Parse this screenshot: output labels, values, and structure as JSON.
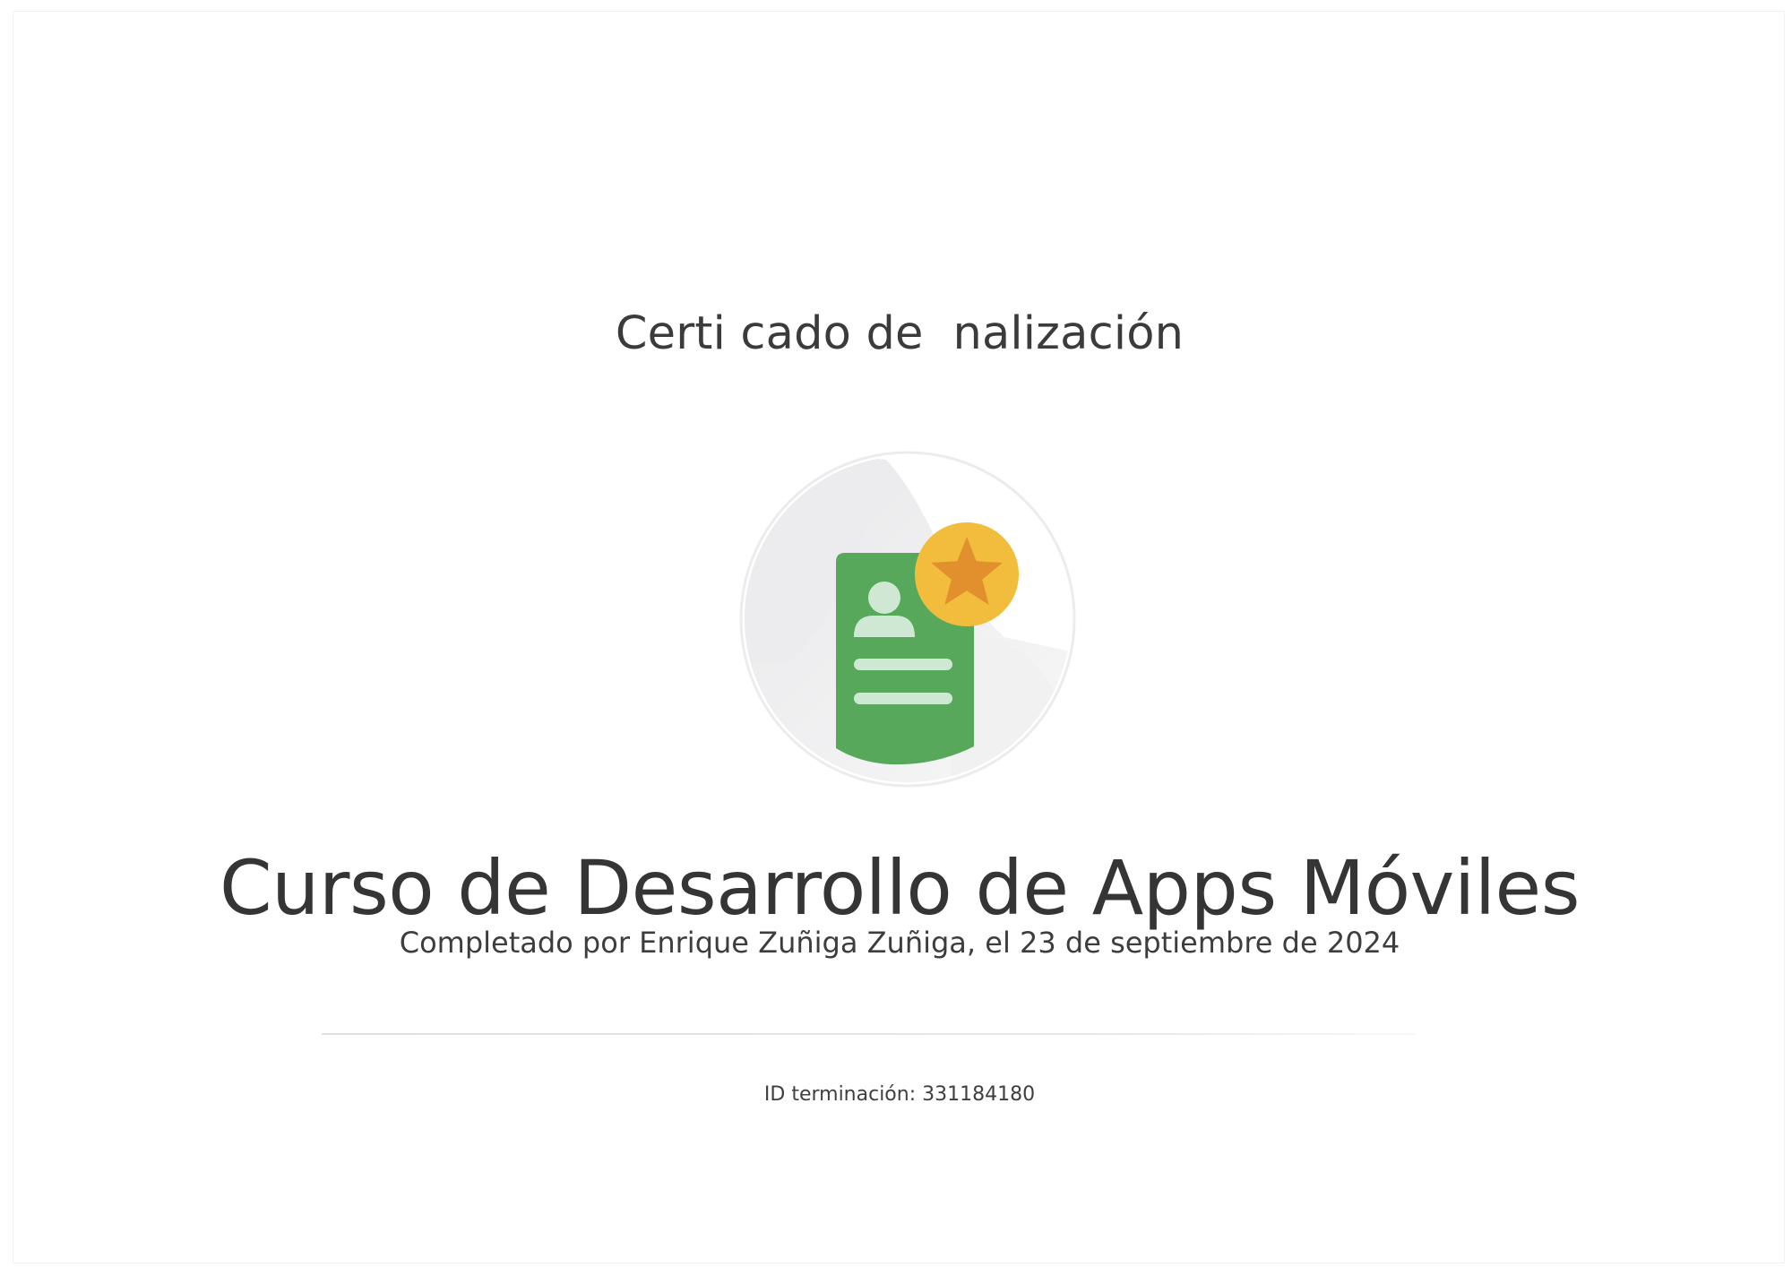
{
  "certificate": {
    "heading": "Certi cado de  nalización",
    "course_title": "Curso de Desarrollo de Apps Móviles",
    "completed_by": "Completado por Enrique Zuñiga Zuñiga, el 23 de septiembre de 2024",
    "completion_id_label": "ID terminación:",
    "completion_id_value": "331184180"
  },
  "badge": {
    "icon": "certificate-badge-icon",
    "colors": {
      "document": "#57a85b",
      "document_details": "#cfe8d3",
      "medal": "#f2bd3c",
      "star": "#e2902e",
      "circle_bg": "#ededee"
    }
  }
}
